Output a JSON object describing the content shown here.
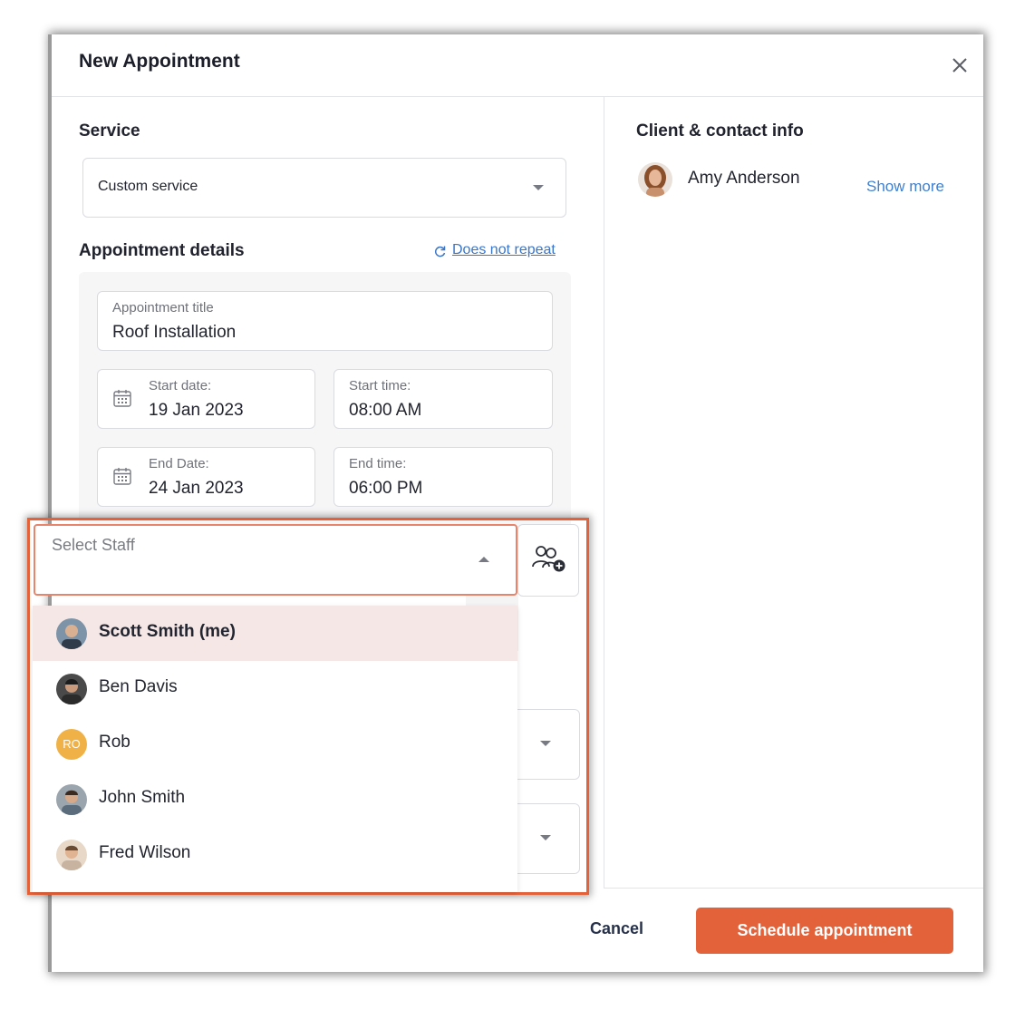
{
  "modal": {
    "title": "New Appointment"
  },
  "service": {
    "heading": "Service",
    "selected": "Custom service"
  },
  "appointment_details": {
    "heading": "Appointment details",
    "repeat_link": "Does not repeat",
    "title_field": {
      "label": "Appointment title",
      "value": "Roof Installation"
    },
    "start_date": {
      "label": "Start date:",
      "value": "19 Jan 2023"
    },
    "start_time": {
      "label": "Start time:",
      "value": "08:00 AM"
    },
    "end_date": {
      "label": "End Date:",
      "value": "24 Jan 2023"
    },
    "end_time": {
      "label": "End time:",
      "value": "06:00 PM"
    }
  },
  "staff": {
    "placeholder": "Select Staff",
    "options": [
      {
        "name": "Scott Smith (me)",
        "avatar": "photo",
        "selected": true
      },
      {
        "name": "Ben Davis",
        "avatar": "photo",
        "selected": false
      },
      {
        "name": "Rob",
        "avatar": "initials",
        "initials": "RO",
        "selected": false
      },
      {
        "name": "John Smith",
        "avatar": "photo",
        "selected": false
      },
      {
        "name": "Fred Wilson",
        "avatar": "photo",
        "selected": false
      }
    ]
  },
  "client": {
    "heading": "Client & contact info",
    "name": "Amy Anderson",
    "show_more": "Show more"
  },
  "footer": {
    "cancel_label": "Cancel",
    "schedule_label": "Schedule appointment"
  },
  "colors": {
    "accent": "#e4623a",
    "link": "#3a76c9",
    "selected_row": "#f5e7e6",
    "initials_badge": "#f0b246"
  }
}
